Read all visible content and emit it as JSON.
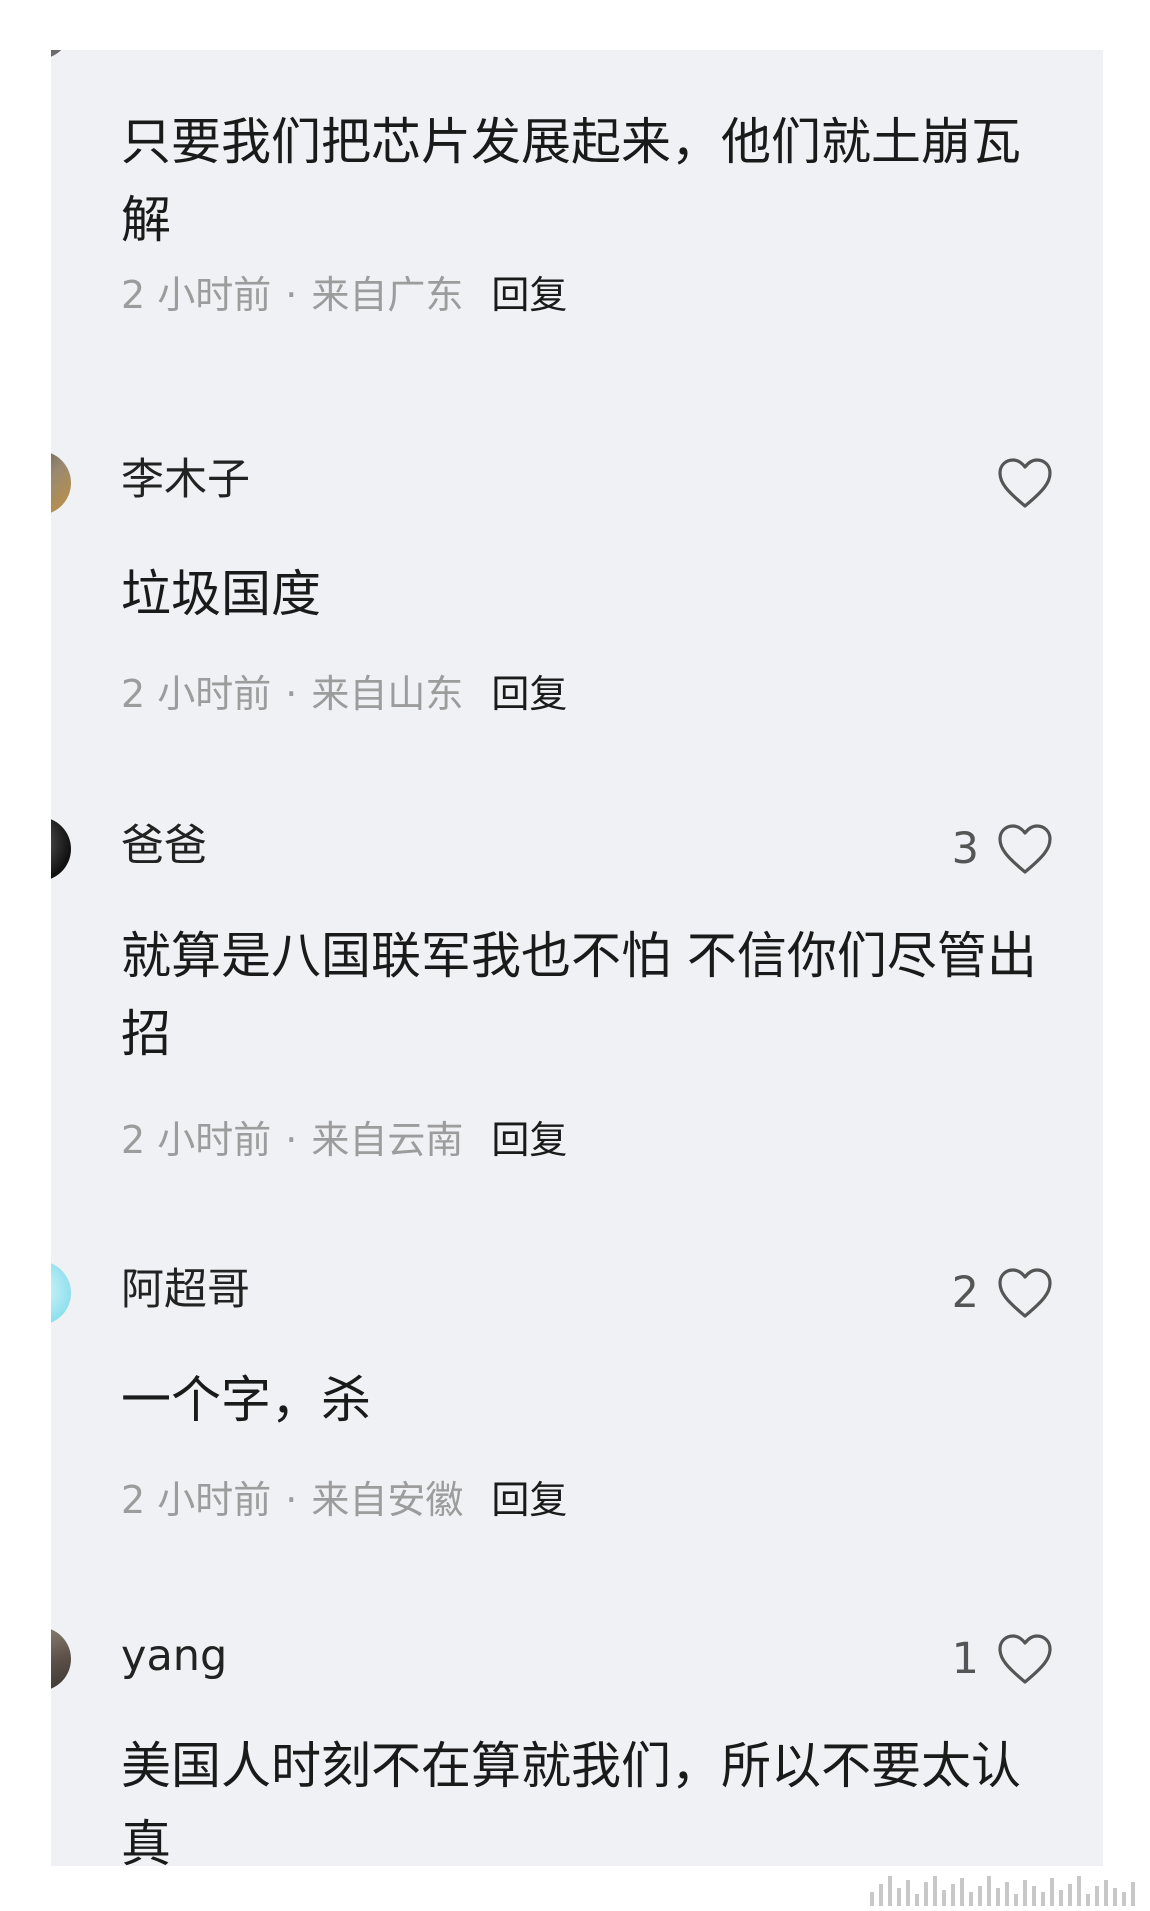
{
  "comments": [
    {
      "username": "",
      "likes": "",
      "text": "只要我们把芯片发展起来，他们就土崩瓦解",
      "time": "2 小时前",
      "location": "来自广东",
      "reply": "回复"
    },
    {
      "username": "李木子",
      "likes": "",
      "text": "垃圾国度",
      "time": "2 小时前",
      "location": "来自山东",
      "reply": "回复"
    },
    {
      "username": "爸爸",
      "likes": "3",
      "text": "就算是八国联军我也不怕  不信你们尽管出招",
      "time": "2 小时前",
      "location": "来自云南",
      "reply": "回复"
    },
    {
      "username": "阿超哥",
      "likes": "2",
      "text": "一个字，杀",
      "time": "2 小时前",
      "location": "来自安徽",
      "reply": "回复"
    },
    {
      "username": "yang",
      "likes": "1",
      "text": "美国人时刻不在算就我们，所以不要太认真",
      "time": "",
      "location": "",
      "reply": ""
    }
  ],
  "meta_separator": "·",
  "colors": {
    "background": "#eff1f4",
    "text": "#1a1a1a",
    "meta": "#9c9c9c",
    "heart": "#555555"
  },
  "icons": {
    "like": "heart-outline-icon"
  }
}
